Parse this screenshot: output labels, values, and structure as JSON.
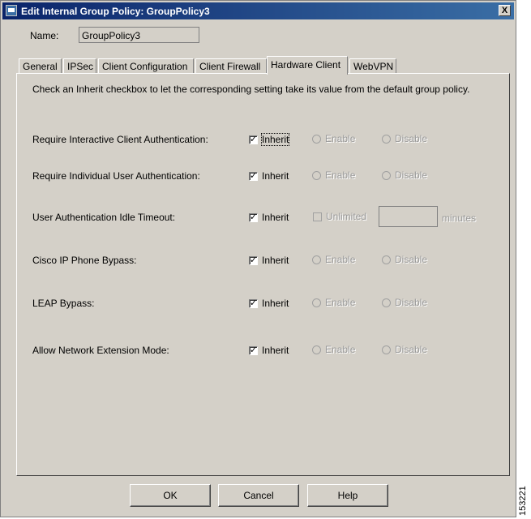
{
  "window": {
    "title": "Edit Internal Group Policy: GroupPolicy3",
    "close_label": "X"
  },
  "name": {
    "label": "Name:",
    "value": "GroupPolicy3"
  },
  "tabs": [
    {
      "label": "General"
    },
    {
      "label": "IPSec"
    },
    {
      "label": "Client Configuration"
    },
    {
      "label": "Client Firewall"
    },
    {
      "label": "Hardware Client"
    },
    {
      "label": "WebVPN"
    }
  ],
  "active_tab": "Hardware Client",
  "instruction": "Check an Inherit checkbox to let the corresponding setting take its value from the default group policy.",
  "rows": [
    {
      "label": "Require Interactive Client Authentication:",
      "inherit": "Inherit",
      "inherit_checked": true,
      "enable": "Enable",
      "disable": "Disable"
    },
    {
      "label": "Require Individual User Authentication:",
      "inherit": "Inherit",
      "inherit_checked": true,
      "enable": "Enable",
      "disable": "Disable"
    },
    {
      "label": "User Authentication Idle Timeout:",
      "inherit": "Inherit",
      "inherit_checked": true,
      "unlimited": "Unlimited",
      "timeout_value": "",
      "minutes": "minutes"
    },
    {
      "label": "Cisco IP Phone Bypass:",
      "inherit": "Inherit",
      "inherit_checked": true,
      "enable": "Enable",
      "disable": "Disable"
    },
    {
      "label": "LEAP Bypass:",
      "inherit": "Inherit",
      "inherit_checked": true,
      "enable": "Enable",
      "disable": "Disable"
    },
    {
      "label": "Allow Network Extension Mode:",
      "inherit": "Inherit",
      "inherit_checked": true,
      "enable": "Enable",
      "disable": "Disable"
    }
  ],
  "buttons": {
    "ok": "OK",
    "cancel": "Cancel",
    "help": "Help"
  },
  "figure_id": "153221",
  "colors": {
    "title_start": "#0a246a",
    "title_end": "#3a6ea5",
    "face": "#d4d0c8",
    "disabled_text": "#9a9a9a"
  },
  "icons": {
    "app": "app-window-icon",
    "close": "close-icon"
  }
}
